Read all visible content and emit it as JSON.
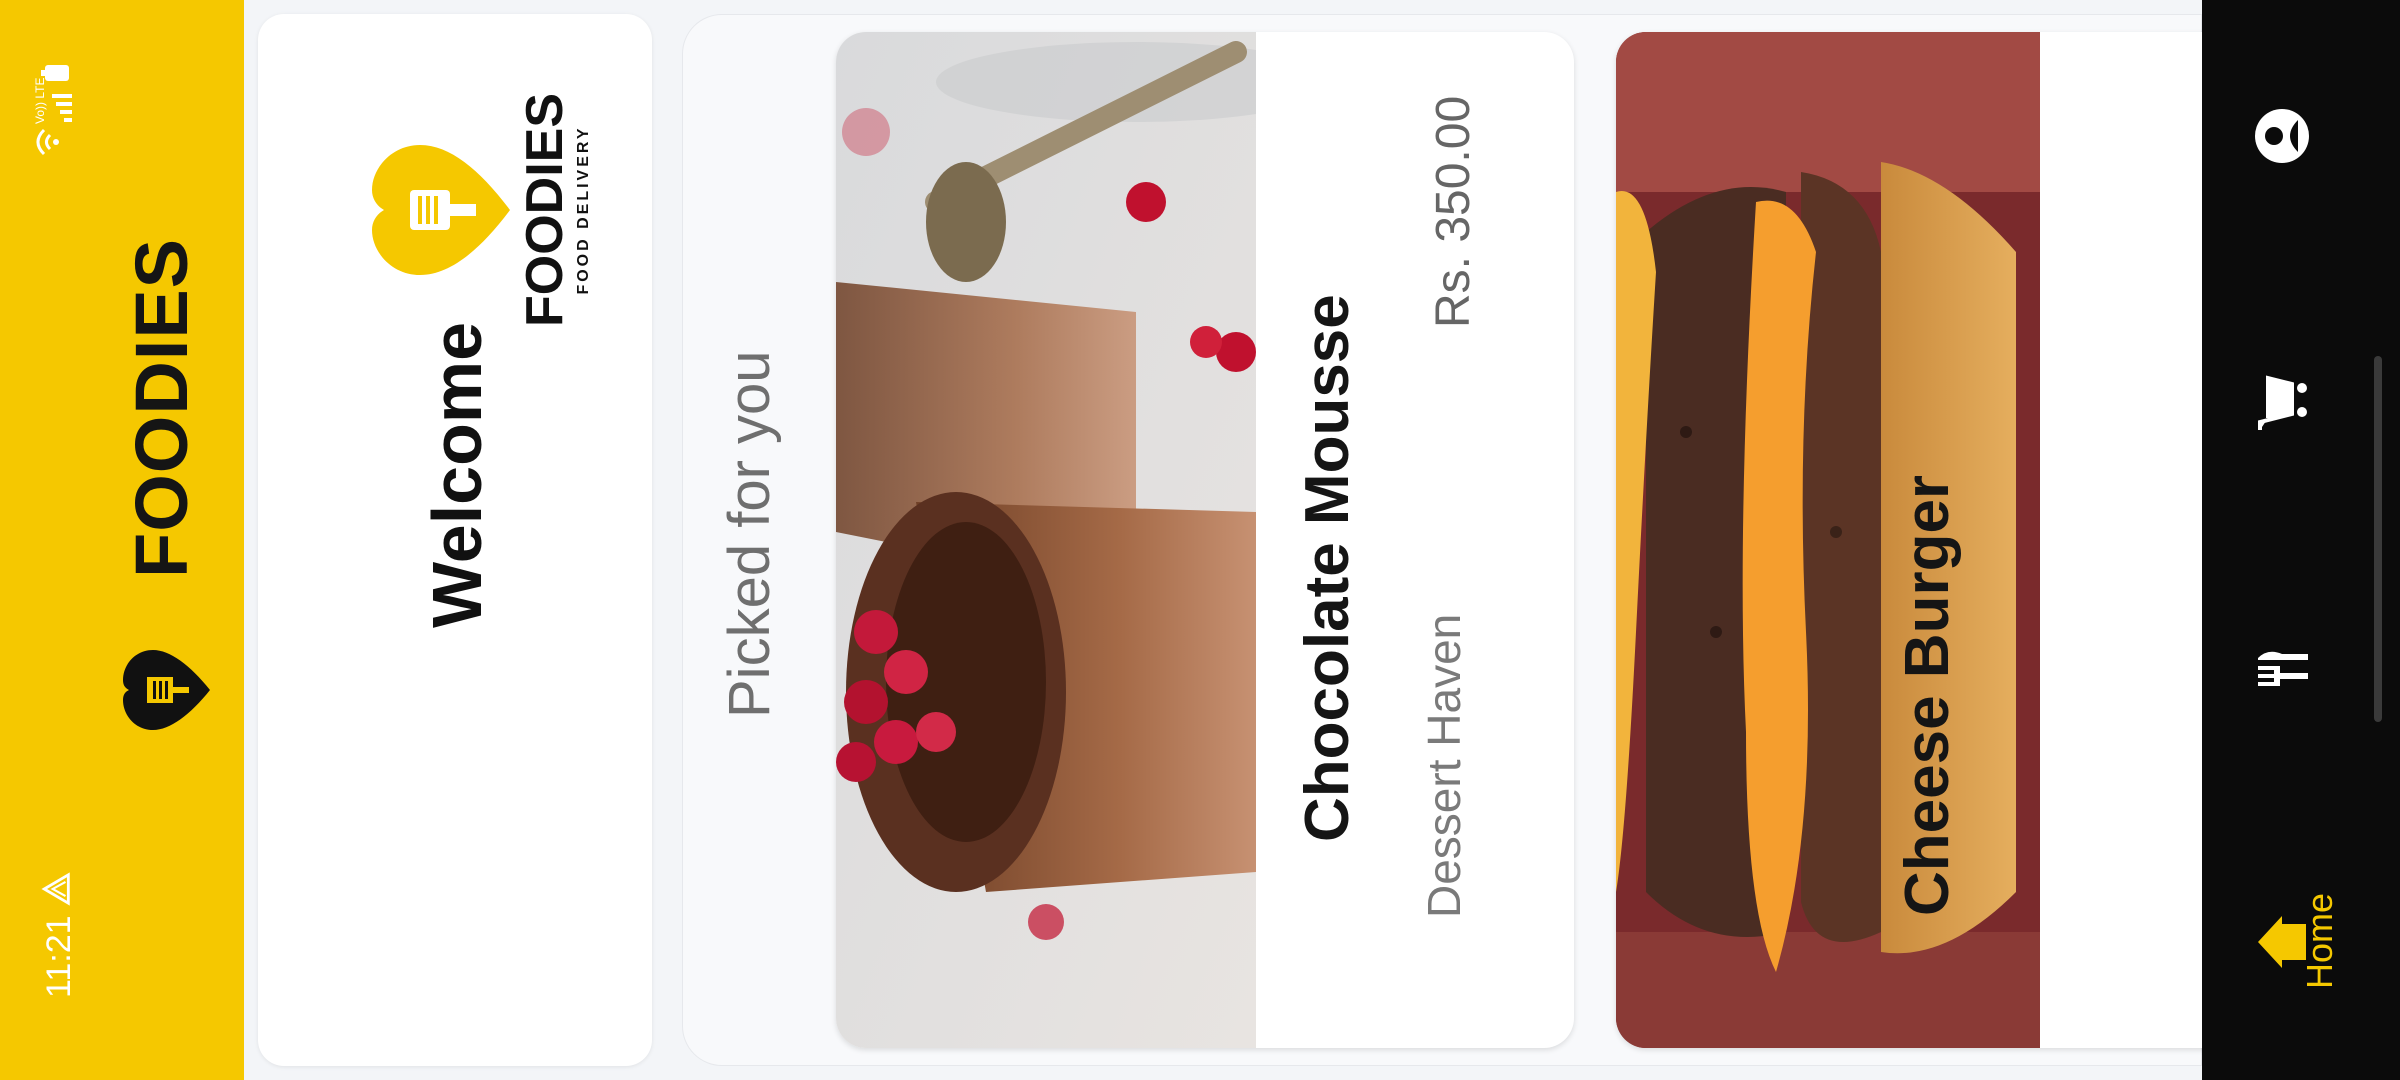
{
  "status_bar": {
    "time": "11:21",
    "network_label": "Vo)) LTE1"
  },
  "app_bar": {
    "title": "FOODIES"
  },
  "welcome_card": {
    "greeting": "Welcome",
    "brand_name": "FOODIES",
    "brand_tagline": "FOOD DELIVERY"
  },
  "picked_section": {
    "title": "Picked for you",
    "items": [
      {
        "name": "Chocolate Mousse",
        "price": "Rs. 350.00",
        "restaurant": "Dessert Haven"
      },
      {
        "name": "Cheese Burger"
      }
    ]
  },
  "nav": {
    "home_label": "Home",
    "items": [
      "home-icon",
      "menu-icon",
      "cart-icon",
      "account-icon"
    ]
  },
  "colors": {
    "brand_yellow": "#f5c800",
    "nav_background": "#0b0b0b"
  }
}
